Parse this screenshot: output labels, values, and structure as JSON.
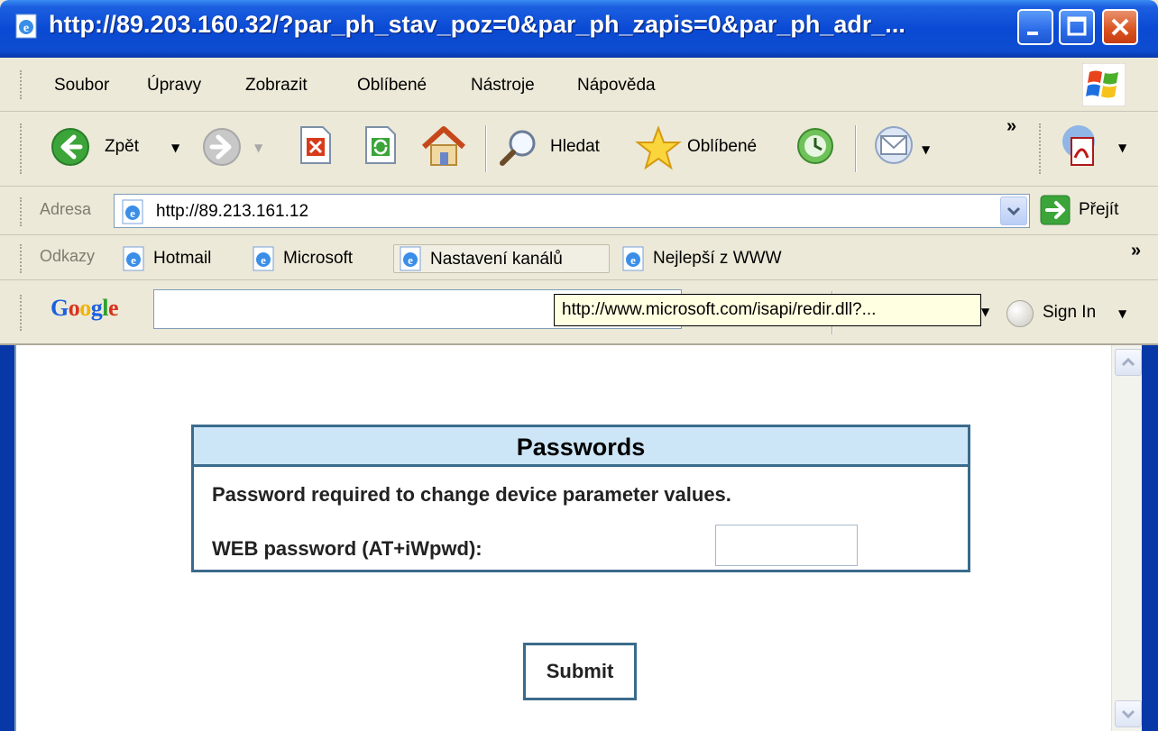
{
  "window": {
    "title": "http://89.203.160.32/?par_ph_stav_poz=0&par_ph_zapis=0&par_ph_adr_...",
    "controls": [
      "minimize",
      "maximize",
      "close"
    ]
  },
  "menu": {
    "items": [
      "Soubor",
      "Úpravy",
      "Zobrazit",
      "Oblíbené",
      "Nástroje",
      "Nápověda"
    ]
  },
  "toolbar": {
    "back_label": "Zpět",
    "search_label": "Hledat",
    "favorites_label": "Oblíbené",
    "overflow": "»"
  },
  "address": {
    "label": "Adresa",
    "value": "http://89.213.161.12",
    "go_label": "Přejít"
  },
  "links": {
    "label": "Odkazy",
    "items": [
      "Hotmail",
      "Microsoft",
      "Nastavení kanálů",
      "Nejlepší z WWW"
    ],
    "overflow": "»"
  },
  "google": {
    "logo": "Google",
    "signin_label": "Sign In",
    "tooltip": "http://www.microsoft.com/isapi/redir.dll?..."
  },
  "page": {
    "table_title": "Passwords",
    "description": "Password required to change device parameter values.",
    "password_label": "WEB password (AT+iWpwd):",
    "password_value": "",
    "submit_label": "Submit"
  },
  "colors": {
    "title_bar": "#0a4ad4",
    "table_border": "#3a6b8c",
    "table_header_bg": "#cde6f7",
    "tooltip_bg": "#ffffe1"
  }
}
